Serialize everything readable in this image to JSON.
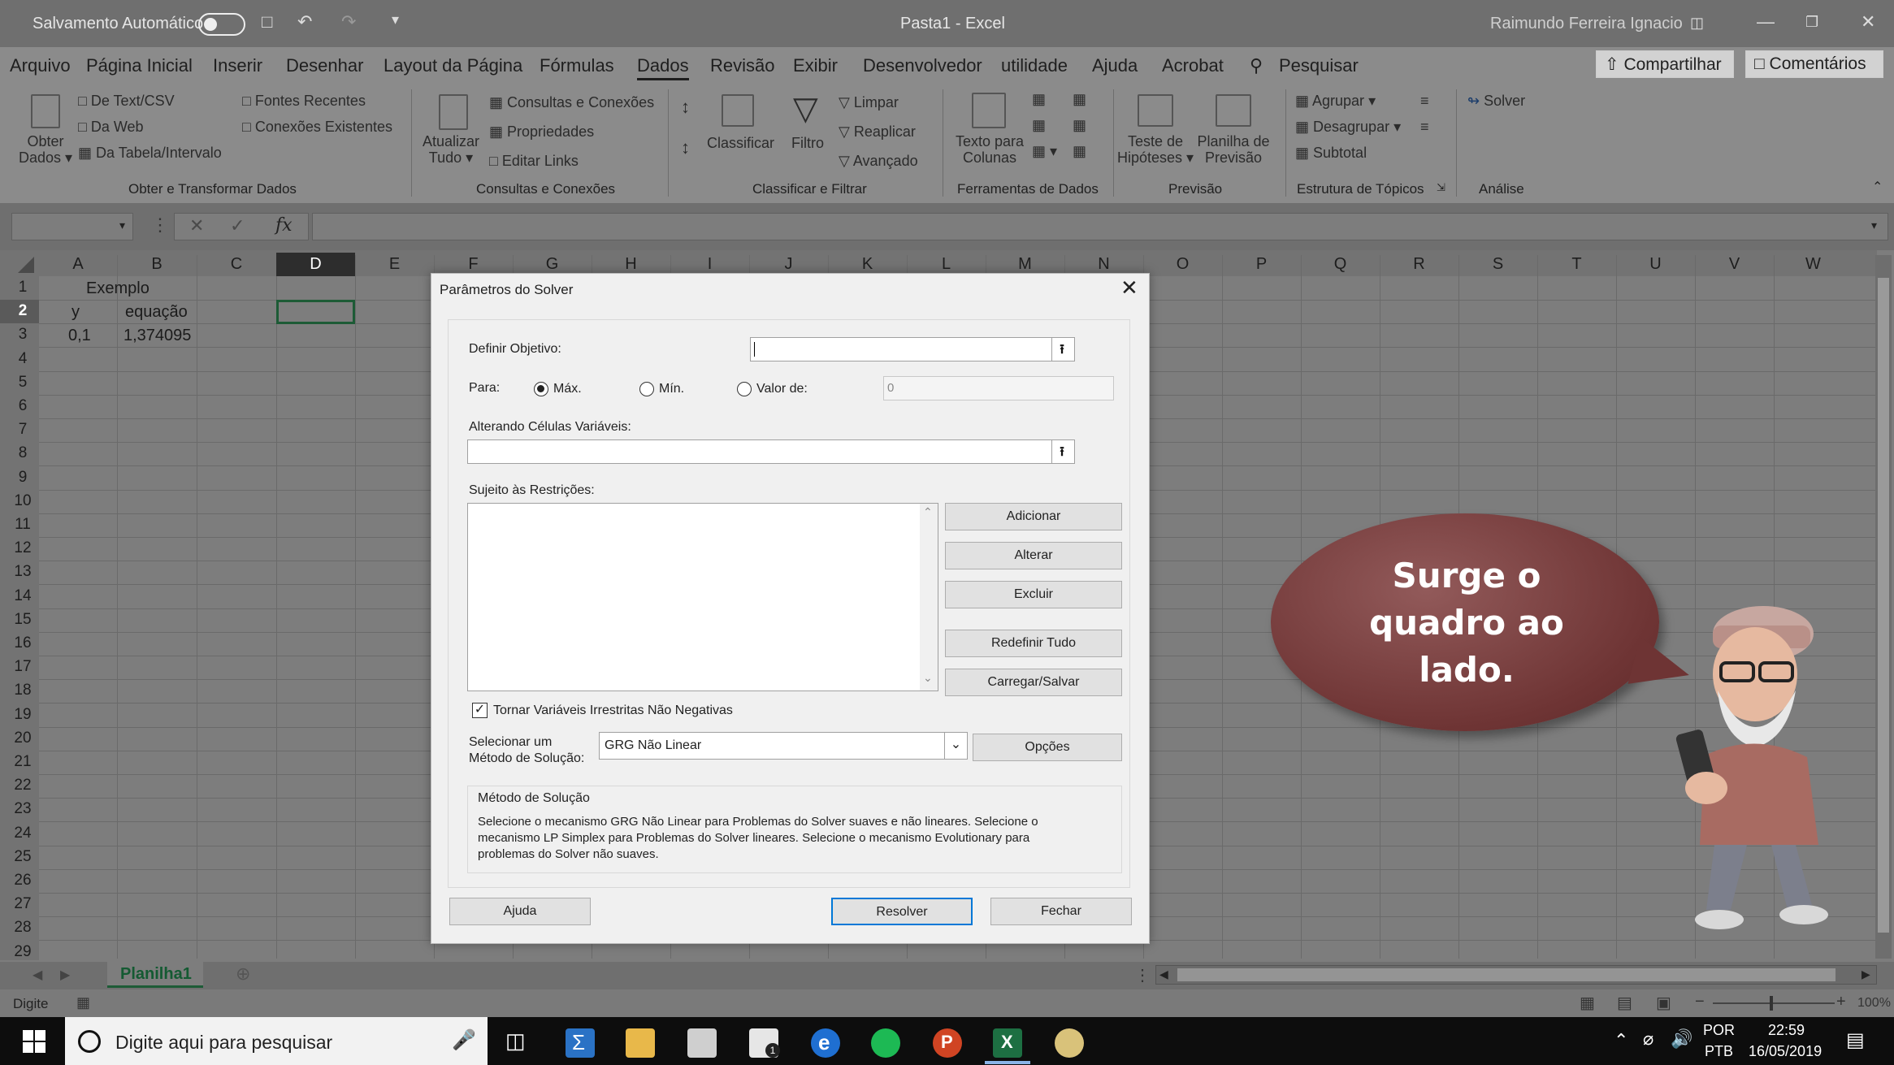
{
  "titlebar": {
    "autosave_label": "Salvamento Automático",
    "doc_title": "Pasta1  -  Excel",
    "user_name": "Raimundo Ferreira Ignacio"
  },
  "menu": {
    "items": [
      "Arquivo",
      "Página Inicial",
      "Inserir",
      "Desenhar",
      "Layout da Página",
      "Fórmulas",
      "Dados",
      "Revisão",
      "Exibir",
      "Desenvolvedor",
      "utilidade",
      "Ajuda",
      "Acrobat"
    ],
    "active": "Dados",
    "search": "Pesquisar",
    "share": "Compartilhar",
    "comments": "Comentários"
  },
  "ribbon": {
    "obter_dados": [
      "Obter",
      "Dados"
    ],
    "from_text_csv": "De Text/CSV",
    "from_web": "Da Web",
    "from_table": "Da Tabela/Intervalo",
    "recent_sources": "Fontes Recentes",
    "existing_connections": "Conexões Existentes",
    "group_get_transform": "Obter e Transformar Dados",
    "refresh_all": [
      "Atualizar",
      "Tudo"
    ],
    "queries_connections": "Consultas e Conexões",
    "properties": "Propriedades",
    "edit_links": "Editar Links",
    "group_queries": "Consultas e Conexões",
    "sort": "Classificar",
    "filter": "Filtro",
    "clear": "Limpar",
    "reapply": "Reaplicar",
    "advanced": "Avançado",
    "group_sort_filter": "Classificar e Filtrar",
    "text_to_columns": [
      "Texto para",
      "Colunas"
    ],
    "group_data_tools": "Ferramentas de Dados",
    "what_if": [
      "Teste de",
      "Hipóteses"
    ],
    "forecast_sheet": [
      "Planilha de",
      "Previsão"
    ],
    "group_forecast": "Previsão",
    "group": "Agrupar",
    "ungroup": "Desagrupar",
    "subtotal": "Subtotal",
    "group_outline": "Estrutura de Tópicos",
    "solver": "Solver",
    "group_analysis": "Análise"
  },
  "formula_bar": {
    "name_box": "",
    "fx": "fx",
    "formula": ""
  },
  "grid": {
    "columns": [
      "A",
      "B",
      "C",
      "D",
      "E",
      "F",
      "G",
      "H",
      "I",
      "J",
      "K",
      "L",
      "M",
      "N",
      "O",
      "P",
      "Q",
      "R",
      "S",
      "T",
      "U",
      "V",
      "W"
    ],
    "rows": [
      "1",
      "2",
      "3",
      "4",
      "5",
      "6",
      "7",
      "8",
      "9",
      "10",
      "11",
      "12",
      "13",
      "14",
      "15",
      "16",
      "17",
      "18",
      "19",
      "20",
      "21",
      "22",
      "23",
      "24",
      "25",
      "26",
      "27",
      "28",
      "29"
    ],
    "selected_col": "D",
    "selected_row": "2",
    "cells": {
      "A1": "Exemplo",
      "A2": "y",
      "B2": "equação",
      "A3": "0,1",
      "B3": "1,374095"
    }
  },
  "dialog": {
    "title": "Parâmetros do Solver",
    "set_objective_label": "Definir Objetivo:",
    "to_label": "Para:",
    "max_label": "Máx.",
    "min_label": "Mín.",
    "value_of_label": "Valor de:",
    "value_of_value": "0",
    "selected_option": "Máx.",
    "changing_cells_label": "Alterando Células Variáveis:",
    "constraints_label": "Sujeito às Restrições:",
    "add_button": "Adicionar",
    "change_button": "Alterar",
    "delete_button": "Excluir",
    "reset_all_button": "Redefinir Tudo",
    "load_save_button": "Carregar/Salvar",
    "nonneg_label": "Tornar Variáveis Irrestritas Não Negativas",
    "nonneg_checked": true,
    "method_label_1": "Selecionar um",
    "method_label_2": "Método de Solução:",
    "method_value": "GRG Não Linear",
    "options_button": "Opções",
    "method_box_title": "Método de Solução",
    "method_description": "Selecione o mecanismo GRG Não Linear para Problemas do Solver suaves e não lineares. Selecione o mecanismo LP Simplex para Problemas do Solver lineares. Selecione o mecanismo Evolutionary para problemas do Solver não suaves.",
    "help_button": "Ajuda",
    "solve_button": "Resolver",
    "close_button": "Fechar"
  },
  "sheet_tabs": {
    "active": "Planilha1"
  },
  "status": {
    "mode": "Digite",
    "zoom": "100%"
  },
  "taskbar": {
    "search_placeholder": "Digite aqui para pesquisar",
    "lang_1": "POR",
    "lang_2": "PTB",
    "time": "22:59",
    "date": "16/05/2019",
    "mail_badge": "1"
  },
  "bubble": {
    "line1": "Surge o",
    "line2": "quadro ao",
    "line3": "lado."
  },
  "colors": {
    "accent": "#217346",
    "dim_overlay": "#8b8b8b",
    "bubble": "#7a3f3f"
  }
}
